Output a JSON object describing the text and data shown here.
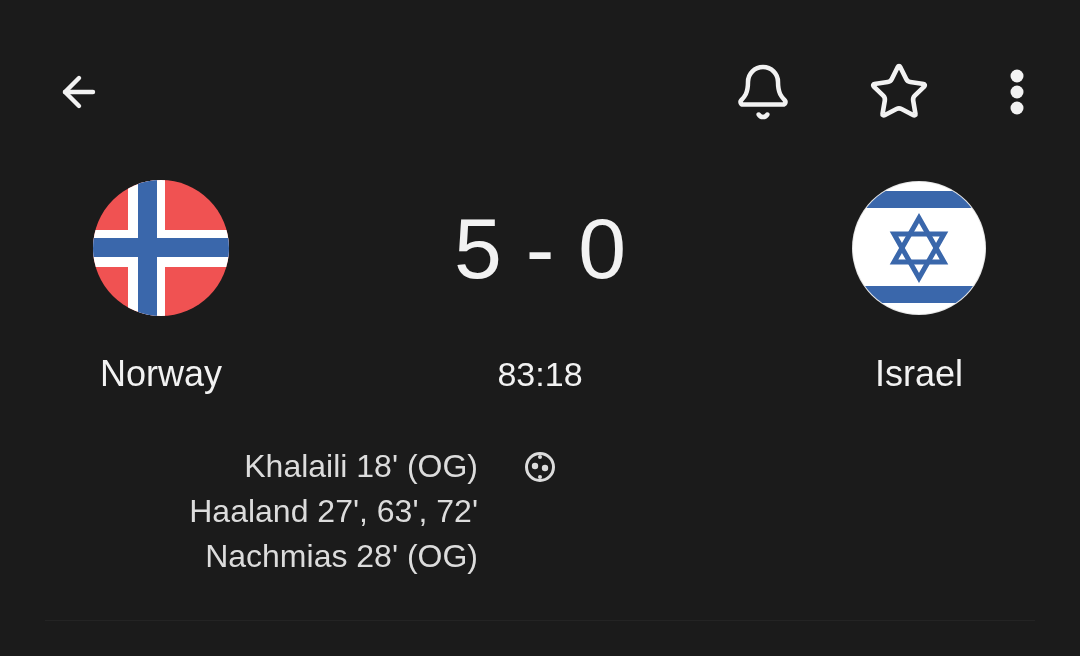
{
  "match": {
    "home": {
      "name": "Norway"
    },
    "score": "5 - 0",
    "clock": "83:18",
    "away": {
      "name": "Israel"
    }
  },
  "goals": {
    "home_scorers": [
      "Khalaili 18' (OG)",
      "Haaland 27', 63', 72'",
      "Nachmias 28' (OG)"
    ]
  }
}
